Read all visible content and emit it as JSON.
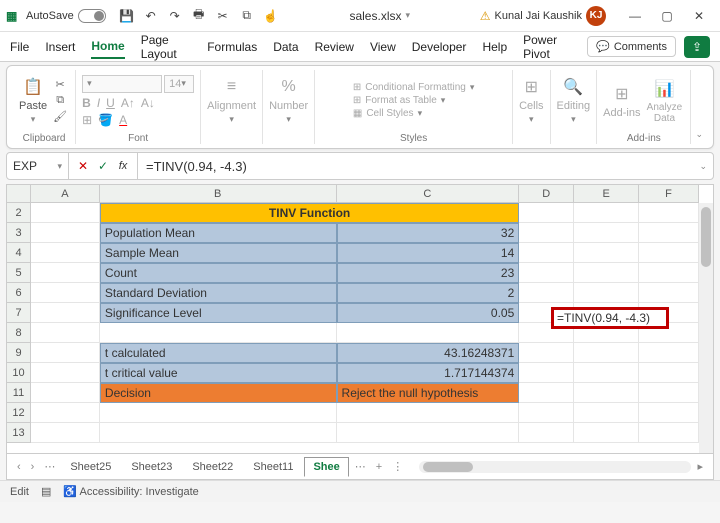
{
  "titlebar": {
    "autosave_label": "AutoSave",
    "autosave_state": "Off",
    "filename": "sales.xlsx",
    "username": "Kunal Jai Kaushik",
    "user_initials": "KJ"
  },
  "tabs": {
    "items": [
      "File",
      "Insert",
      "Home",
      "Page Layout",
      "Formulas",
      "Data",
      "Review",
      "View",
      "Developer",
      "Help",
      "Power Pivot"
    ],
    "active": "Home",
    "comments": "Comments"
  },
  "ribbon": {
    "clipboard": {
      "paste": "Paste",
      "label": "Clipboard"
    },
    "font": {
      "size": "14",
      "label": "Font"
    },
    "alignment": {
      "btn": "Alignment"
    },
    "number": {
      "btn": "Number"
    },
    "styles": {
      "cond": "Conditional Formatting",
      "table": "Format as Table",
      "cellstyles": "Cell Styles",
      "label": "Styles"
    },
    "cells": {
      "btn": "Cells"
    },
    "editing": {
      "btn": "Editing"
    },
    "addins": {
      "addins": "Add-ins",
      "analyze": "Analyze Data",
      "label": "Add-ins"
    }
  },
  "formula_bar": {
    "name_box": "EXP",
    "formula": "=TINV(0.94, -4.3)"
  },
  "columns": [
    "A",
    "B",
    "C",
    "D",
    "E",
    "F"
  ],
  "rows": [
    "2",
    "3",
    "4",
    "5",
    "6",
    "7",
    "8",
    "9",
    "10",
    "11",
    "12",
    "13"
  ],
  "cells": {
    "header": "TINV Function",
    "b3": "Population Mean",
    "c3": "32",
    "b4": "Sample Mean",
    "c4": "14",
    "b5": "Count",
    "c5": "23",
    "b6": "Standard Deviation",
    "c6": "2",
    "b7": "Significance Level",
    "c7": "0.05",
    "b9": "t calculated",
    "c9": "43.16248371",
    "b10": "t critical value",
    "c10": "1.717144374",
    "b11": "Decision",
    "c11": "Reject the null hypothesis",
    "e8": "=TINV(0.94, -4.3)"
  },
  "sheet_tabs": {
    "items": [
      "Sheet25",
      "Sheet23",
      "Sheet22",
      "Sheet11",
      "Shee"
    ],
    "active_partial": "Shee"
  },
  "statusbar": {
    "mode": "Edit",
    "accessibility": "Accessibility: Investigate"
  }
}
